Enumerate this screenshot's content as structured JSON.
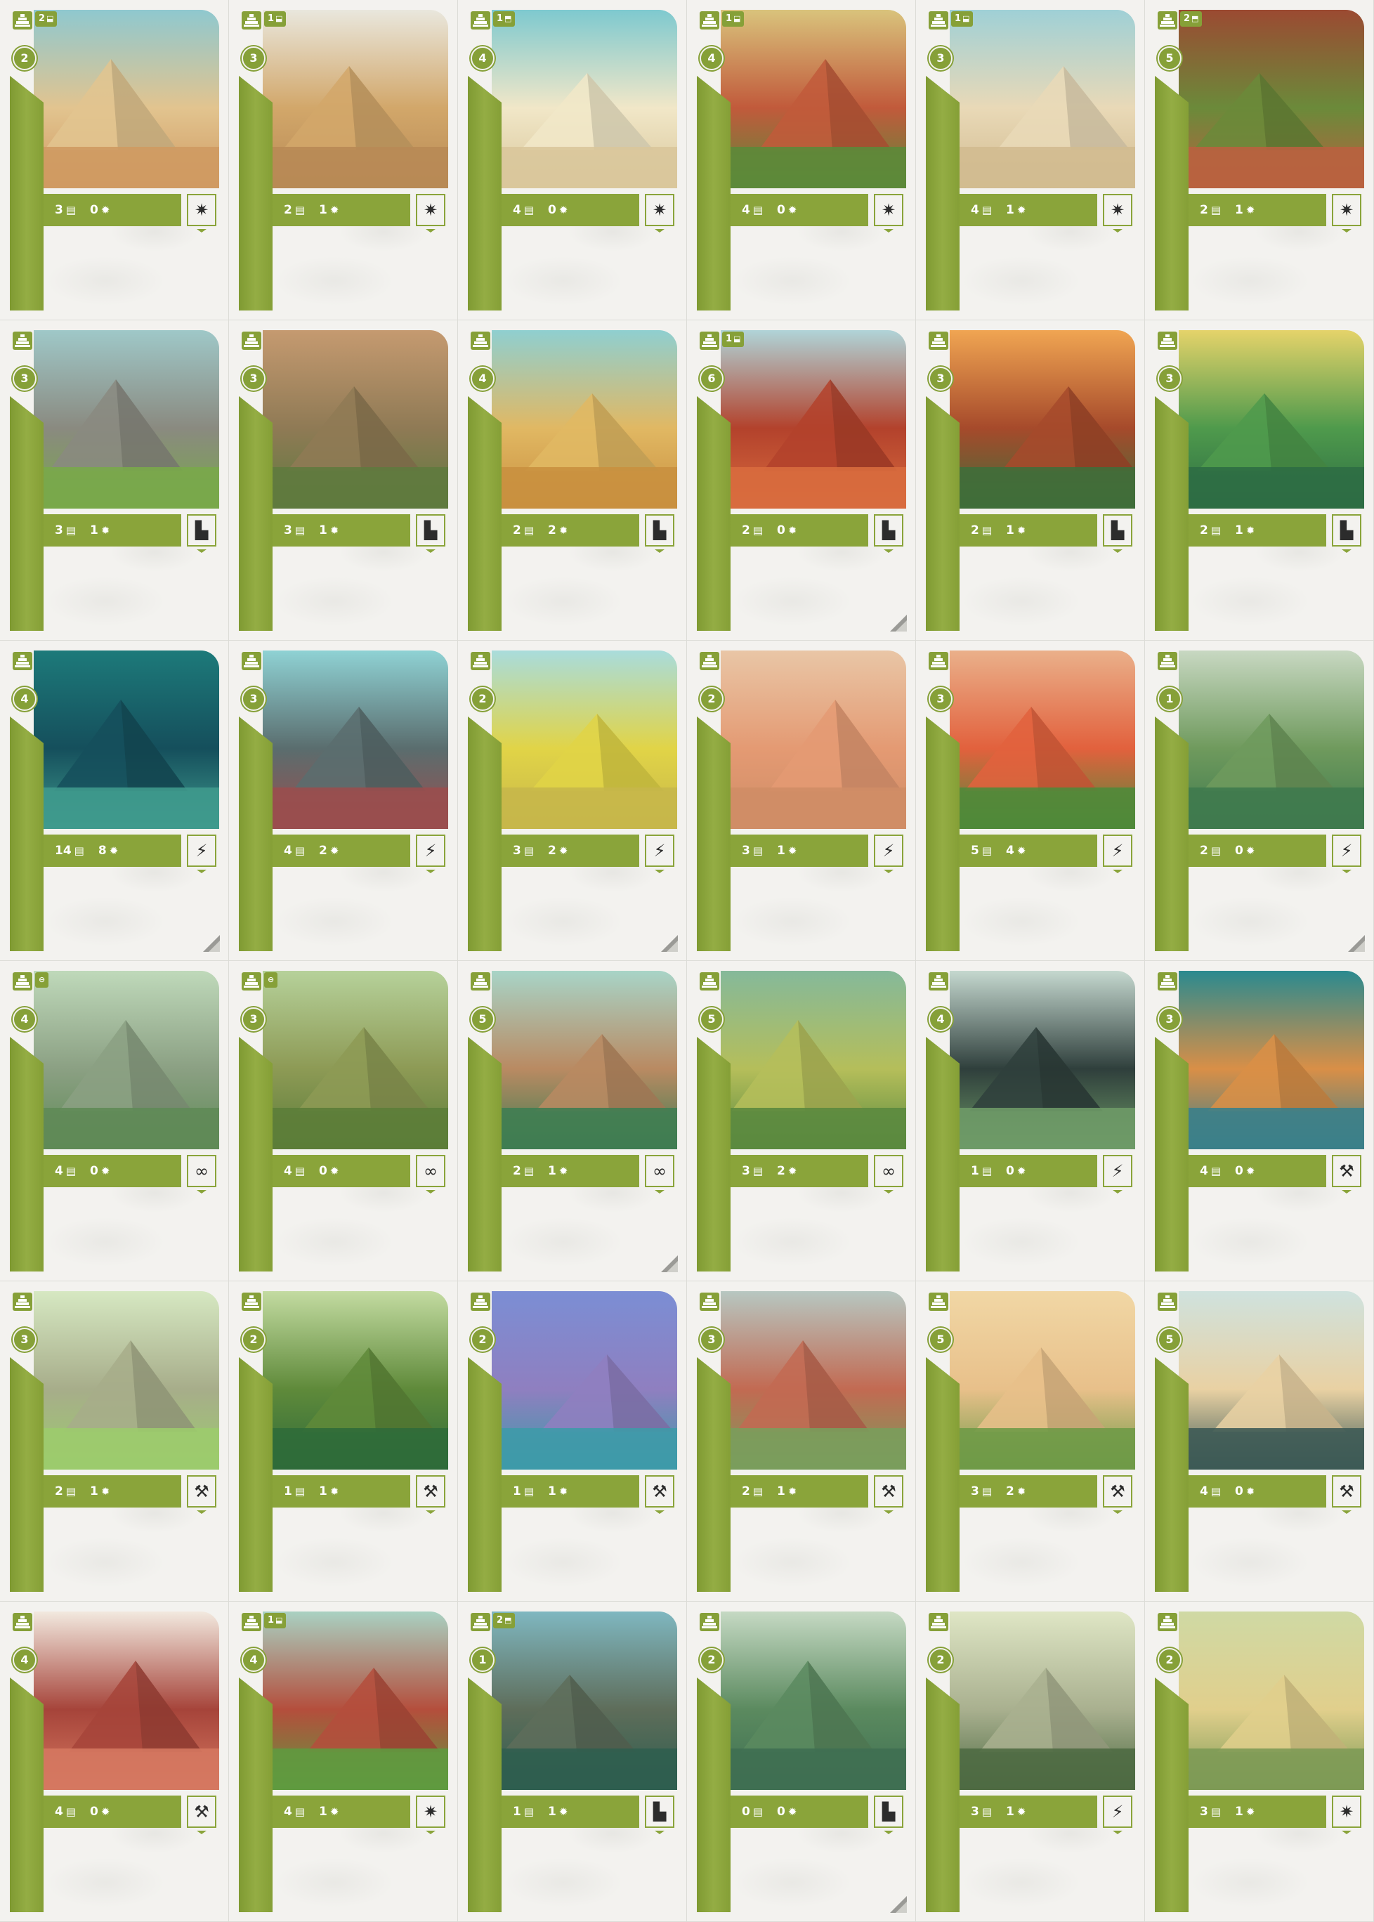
{
  "colors": {
    "accent": "#8aa43a",
    "card_bg": "#f3f2ef",
    "text_on_accent": "#ffffff",
    "icon_dark": "#2c2c2c"
  },
  "rows": [
    {
      "cards": [
        {
          "rank": "2",
          "ability": {
            "count": "2",
            "icon": "cup-cross-icon"
          },
          "stats": {
            "cards": "3",
            "points": "0"
          },
          "type_icon": "compass-star-icon",
          "type_glyph": "✷",
          "corner": false,
          "palette": [
            "#8fc8cf",
            "#e2c48f",
            "#cf9a62"
          ]
        },
        {
          "rank": "3",
          "ability": {
            "count": "1",
            "icon": "cup-cross-icon"
          },
          "stats": {
            "cards": "2",
            "points": "1"
          },
          "type_icon": "compass-star-icon",
          "type_glyph": "✷",
          "corner": false,
          "palette": [
            "#e9e7dd",
            "#d2a76a",
            "#b88a55"
          ]
        },
        {
          "rank": "4",
          "ability": {
            "count": "1",
            "icon": "cup-up-icon"
          },
          "stats": {
            "cards": "4",
            "points": "0"
          },
          "type_icon": "compass-star-icon",
          "type_glyph": "✷",
          "corner": false,
          "palette": [
            "#7ec9cf",
            "#f1e7c8",
            "#d9c79b"
          ]
        },
        {
          "rank": "4",
          "ability": {
            "count": "1",
            "icon": "cup-cross-icon"
          },
          "stats": {
            "cards": "4",
            "points": "0"
          },
          "type_icon": "compass-star-icon",
          "type_glyph": "✷",
          "corner": false,
          "palette": [
            "#d9c37c",
            "#c15a3b",
            "#5c8a3a"
          ]
        },
        {
          "rank": "3",
          "ability": {
            "count": "1",
            "icon": "cup-cross-icon"
          },
          "stats": {
            "cards": "4",
            "points": "1"
          },
          "type_icon": "compass-star-icon",
          "type_glyph": "✷",
          "corner": false,
          "palette": [
            "#9fd0d6",
            "#e9d9b7",
            "#d1bb90"
          ]
        },
        {
          "rank": "5",
          "ability": {
            "count": "2",
            "icon": "cup-up-icon"
          },
          "stats": {
            "cards": "2",
            "points": "1"
          },
          "type_icon": "compass-star-icon",
          "type_glyph": "✷",
          "corner": false,
          "palette": [
            "#9b4a32",
            "#6b8a3a",
            "#b9623f"
          ]
        }
      ]
    },
    {
      "cards": [
        {
          "rank": "3",
          "ability": null,
          "stats": {
            "cards": "3",
            "points": "1"
          },
          "type_icon": "staircase-icon",
          "type_glyph": "▙",
          "corner": false,
          "palette": [
            "#9fc8c8",
            "#8a8a80",
            "#79a84a"
          ]
        },
        {
          "rank": "3",
          "ability": null,
          "stats": {
            "cards": "3",
            "points": "1"
          },
          "type_icon": "staircase-icon",
          "type_glyph": "▙",
          "corner": false,
          "palette": [
            "#c59a70",
            "#8f7a55",
            "#5f7a3e"
          ]
        },
        {
          "rank": "4",
          "ability": null,
          "stats": {
            "cards": "2",
            "points": "2"
          },
          "type_icon": "staircase-icon",
          "type_glyph": "▙",
          "corner": false,
          "palette": [
            "#8fcfd0",
            "#e1b863",
            "#c9903f"
          ]
        },
        {
          "rank": "6",
          "ability": {
            "count": "1",
            "icon": "cup-lock-icon"
          },
          "stats": {
            "cards": "2",
            "points": "0"
          },
          "type_icon": "staircase-icon",
          "type_glyph": "▙",
          "corner": true,
          "palette": [
            "#b0d4d8",
            "#b3422c",
            "#d86b3e"
          ]
        },
        {
          "rank": "3",
          "ability": null,
          "stats": {
            "cards": "2",
            "points": "1"
          },
          "type_icon": "staircase-icon",
          "type_glyph": "▙",
          "corner": false,
          "palette": [
            "#f0a552",
            "#a64a2b",
            "#3f6e3a"
          ]
        },
        {
          "rank": "3",
          "ability": null,
          "stats": {
            "cards": "2",
            "points": "1"
          },
          "type_icon": "staircase-icon",
          "type_glyph": "▙",
          "corner": false,
          "palette": [
            "#e5d36a",
            "#4f9a4c",
            "#2d6d44"
          ]
        }
      ]
    },
    {
      "cards": [
        {
          "rank": "4",
          "ability": null,
          "stats": {
            "cards": "14",
            "points": "8"
          },
          "type_icon": "lightning-icon",
          "type_glyph": "⚡",
          "corner": true,
          "palette": [
            "#1d7a7a",
            "#154f5c",
            "#3f9a8d"
          ]
        },
        {
          "rank": "3",
          "ability": null,
          "stats": {
            "cards": "4",
            "points": "2"
          },
          "type_icon": "lightning-icon",
          "type_glyph": "⚡",
          "corner": false,
          "palette": [
            "#8fd2d4",
            "#5a6d6e",
            "#9a4e4e"
          ]
        },
        {
          "rank": "2",
          "ability": null,
          "stats": {
            "cards": "3",
            "points": "2"
          },
          "type_icon": "lightning-icon",
          "type_glyph": "⚡",
          "corner": true,
          "palette": [
            "#a9dcdc",
            "#e1d447",
            "#c7b74a"
          ]
        },
        {
          "rank": "2",
          "ability": null,
          "stats": {
            "cards": "3",
            "points": "1"
          },
          "type_icon": "lightning-icon",
          "type_glyph": "⚡",
          "corner": false,
          "palette": [
            "#e9c6a6",
            "#e49a73",
            "#cf8d66"
          ]
        },
        {
          "rank": "3",
          "ability": null,
          "stats": {
            "cards": "5",
            "points": "4"
          },
          "type_icon": "lightning-icon",
          "type_glyph": "⚡",
          "corner": false,
          "palette": [
            "#eab08a",
            "#e2613d",
            "#4f8a3a"
          ]
        },
        {
          "rank": "1",
          "ability": null,
          "stats": {
            "cards": "2",
            "points": "0"
          },
          "type_icon": "lightning-icon",
          "type_glyph": "⚡",
          "corner": true,
          "palette": [
            "#c8d8c2",
            "#6f9a5d",
            "#3f7a4e"
          ]
        }
      ]
    },
    {
      "cards": [
        {
          "rank": "4",
          "ability": {
            "count": "",
            "icon": "lock-icon"
          },
          "stats": {
            "cards": "4",
            "points": "0"
          },
          "type_icon": "infinity-icon",
          "type_glyph": "∞",
          "corner": false,
          "palette": [
            "#bfd9ba",
            "#8ba083",
            "#5f8a56"
          ]
        },
        {
          "rank": "3",
          "ability": {
            "count": "",
            "icon": "lock-icon"
          },
          "stats": {
            "cards": "4",
            "points": "0"
          },
          "type_icon": "infinity-icon",
          "type_glyph": "∞",
          "corner": false,
          "palette": [
            "#b6d19a",
            "#8d9a55",
            "#5c7d39"
          ]
        },
        {
          "rank": "5",
          "ability": null,
          "stats": {
            "cards": "2",
            "points": "1"
          },
          "type_icon": "infinity-icon",
          "type_glyph": "∞",
          "corner": true,
          "palette": [
            "#a8d4c7",
            "#b98a62",
            "#3f7d52"
          ]
        },
        {
          "rank": "5",
          "ability": null,
          "stats": {
            "cards": "3",
            "points": "2"
          },
          "type_icon": "infinity-icon",
          "type_glyph": "∞",
          "corner": false,
          "palette": [
            "#85b99a",
            "#b5be5a",
            "#5b8a3f"
          ]
        },
        {
          "rank": "4",
          "ability": null,
          "stats": {
            "cards": "1",
            "points": "0"
          },
          "type_icon": "lightning-icon",
          "type_glyph": "⚡",
          "corner": false,
          "palette": [
            "#c5d8cf",
            "#2f3f3c",
            "#6e9a67"
          ]
        },
        {
          "rank": "3",
          "ability": null,
          "stats": {
            "cards": "4",
            "points": "0"
          },
          "type_icon": "hammer-icon",
          "type_glyph": "⚒",
          "corner": false,
          "palette": [
            "#2b8a8f",
            "#d98f47",
            "#3b7f8a"
          ]
        }
      ]
    },
    {
      "cards": [
        {
          "rank": "3",
          "ability": null,
          "stats": {
            "cards": "2",
            "points": "1"
          },
          "type_icon": "hammer-icon",
          "type_glyph": "⚒",
          "corner": false,
          "palette": [
            "#d6e8c2",
            "#a7ad8a",
            "#9ccb6d"
          ]
        },
        {
          "rank": "2",
          "ability": null,
          "stats": {
            "cards": "1",
            "points": "1"
          },
          "type_icon": "hammer-icon",
          "type_glyph": "⚒",
          "corner": false,
          "palette": [
            "#c3dba1",
            "#5f8a3a",
            "#2f6b3a"
          ]
        },
        {
          "rank": "2",
          "ability": null,
          "stats": {
            "cards": "1",
            "points": "1"
          },
          "type_icon": "hammer-icon",
          "type_glyph": "⚒",
          "corner": false,
          "palette": [
            "#7b8ed4",
            "#8f7fc0",
            "#3e9aa8"
          ]
        },
        {
          "rank": "3",
          "ability": null,
          "stats": {
            "cards": "2",
            "points": "1"
          },
          "type_icon": "hammer-icon",
          "type_glyph": "⚒",
          "corner": false,
          "palette": [
            "#b7c7c1",
            "#c26a52",
            "#7a9d5c"
          ]
        },
        {
          "rank": "5",
          "ability": null,
          "stats": {
            "cards": "3",
            "points": "2"
          },
          "type_icon": "hammer-icon",
          "type_glyph": "⚒",
          "corner": false,
          "palette": [
            "#f1d7a5",
            "#e8c08a",
            "#6f9a47"
          ]
        },
        {
          "rank": "5",
          "ability": null,
          "stats": {
            "cards": "4",
            "points": "0"
          },
          "type_icon": "hammer-icon",
          "type_glyph": "⚒",
          "corner": false,
          "palette": [
            "#cfe2de",
            "#e9d1a3",
            "#3d5a55"
          ]
        }
      ]
    },
    {
      "cards": [
        {
          "rank": "4",
          "ability": null,
          "stats": {
            "cards": "4",
            "points": "0"
          },
          "type_icon": "hammer-icon",
          "type_glyph": "⚒",
          "corner": false,
          "palette": [
            "#f2e9df",
            "#a6443a",
            "#d57860"
          ]
        },
        {
          "rank": "4",
          "ability": {
            "count": "1",
            "icon": "cup-cross-icon"
          },
          "stats": {
            "cards": "4",
            "points": "1"
          },
          "type_icon": "compass-star-icon",
          "type_glyph": "✷",
          "corner": false,
          "palette": [
            "#a9d1c2",
            "#b44e3c",
            "#5f9a3f"
          ]
        },
        {
          "rank": "1",
          "ability": {
            "count": "2",
            "icon": "cup-up-icon"
          },
          "stats": {
            "cards": "1",
            "points": "1"
          },
          "type_icon": "staircase-icon",
          "type_glyph": "▙",
          "corner": false,
          "palette": [
            "#7fb7c0",
            "#5e6d5a",
            "#2f5e4f"
          ]
        },
        {
          "rank": "2",
          "ability": null,
          "stats": {
            "cards": "0",
            "points": "0"
          },
          "type_icon": "staircase-icon",
          "type_glyph": "▙",
          "corner": true,
          "palette": [
            "#c5d9c3",
            "#5b8a5f",
            "#3f6f52"
          ]
        },
        {
          "rank": "2",
          "ability": null,
          "stats": {
            "cards": "3",
            "points": "1"
          },
          "type_icon": "lightning-icon",
          "type_glyph": "⚡",
          "corner": false,
          "palette": [
            "#dfe6c5",
            "#a9b08f",
            "#4e6a42"
          ]
        },
        {
          "rank": "2",
          "ability": null,
          "stats": {
            "cards": "3",
            "points": "1"
          },
          "type_icon": "compass-star-icon",
          "type_glyph": "✷",
          "corner": false,
          "palette": [
            "#cfd9a4",
            "#e1cf8c",
            "#7d9a55"
          ]
        }
      ]
    }
  ]
}
